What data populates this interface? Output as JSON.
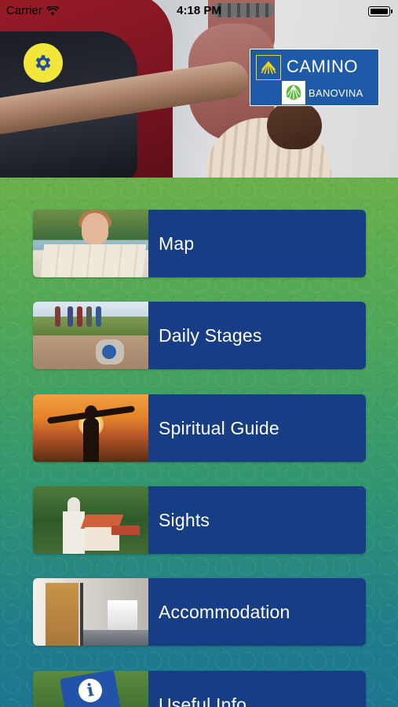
{
  "status_bar": {
    "carrier": "Carrier",
    "time": "4:18 PM"
  },
  "header": {
    "logo_title": "CAMINO",
    "logo_subtitle": "BANOVINA",
    "settings_icon": "gear-icon"
  },
  "menu": {
    "items": [
      {
        "label": "Map",
        "thumb": "woman-reading-map"
      },
      {
        "label": "Daily Stages",
        "thumb": "hikers-on-trail"
      },
      {
        "label": "Spiritual Guide",
        "thumb": "person-at-sunset"
      },
      {
        "label": "Sights",
        "thumb": "church-village"
      },
      {
        "label": "Accommodation",
        "thumb": "hotel-corridor"
      },
      {
        "label": "Useful Info",
        "thumb": "info-sign"
      }
    ]
  },
  "colors": {
    "settings_button": "#f3e63b",
    "menu_item_bg": "#173e84",
    "logo_bg": "#1e5aa8"
  }
}
